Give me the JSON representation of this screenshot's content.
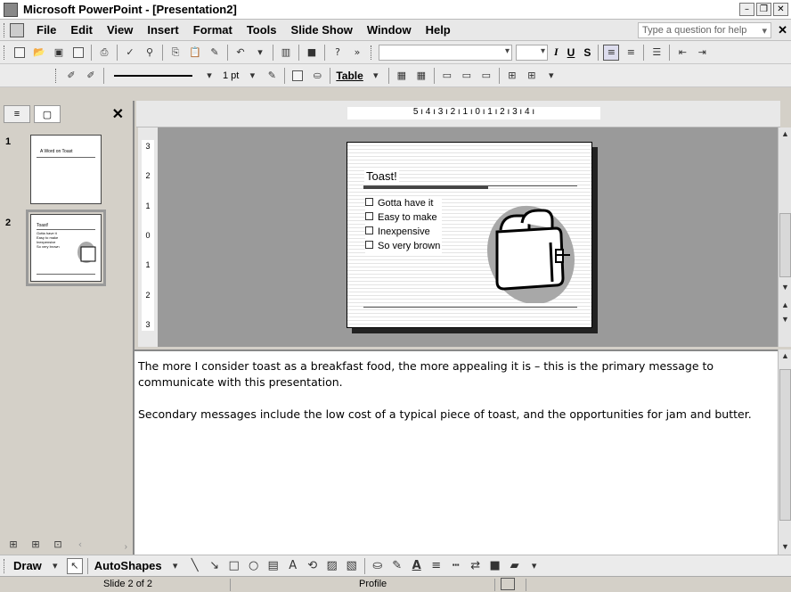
{
  "window": {
    "title": "Microsoft PowerPoint - [Presentation2]"
  },
  "menu": {
    "items": [
      "File",
      "Edit",
      "View",
      "Insert",
      "Format",
      "Tools",
      "Slide Show",
      "Window",
      "Help"
    ],
    "help_placeholder": "Type a question for help"
  },
  "formatting": {
    "italic": "I",
    "underline": "U",
    "shadow": "S",
    "line_weight": "1 pt",
    "table_label": "Table"
  },
  "thumbnails": [
    {
      "number": "1",
      "title": "A Word on Toast"
    },
    {
      "number": "2",
      "title": "Toast!",
      "bullets": [
        "Gotta have it",
        "Easy to make",
        "Inexpensive",
        "So very brown"
      ]
    }
  ],
  "ruler": {
    "horizontal": "5 ı 4 ı 3 ı 2 ı 1 ı 0 ı 1 ı 2 ı 3 ı 4 ı",
    "vertical": [
      "3",
      "2",
      "1",
      "0",
      "1",
      "2",
      "3"
    ]
  },
  "slide": {
    "title": "Toast!",
    "bullets": [
      "Gotta have it",
      "Easy to make",
      "Inexpensive",
      "So very brown"
    ]
  },
  "notes": {
    "paragraphs": [
      "The more I consider toast as a breakfast food, the more appealing it is – this is the primary message to communicate with this presentation.",
      "Secondary messages include the low cost of a typical piece of toast, and the opportunities for jam and butter."
    ]
  },
  "drawbar": {
    "draw": "Draw",
    "autoshapes": "AutoShapes"
  },
  "status": {
    "slide": "Slide 2 of 2",
    "design": "Profile"
  }
}
